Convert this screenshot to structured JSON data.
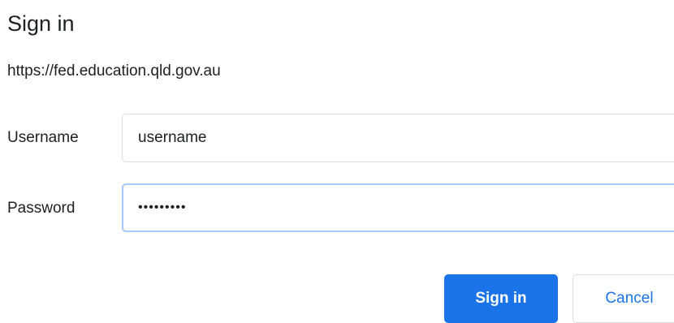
{
  "dialog": {
    "title": "Sign in",
    "origin": "https://fed.education.qld.gov.au"
  },
  "form": {
    "username_label": "Username",
    "username_value": "username",
    "password_label": "Password",
    "password_value": "•••••••••"
  },
  "buttons": {
    "sign_in_label": "Sign in",
    "cancel_label": "Cancel"
  },
  "colors": {
    "primary": "#1a73e8",
    "focus_border": "#a8c7fa",
    "border": "#dadce0",
    "text": "#202124"
  }
}
